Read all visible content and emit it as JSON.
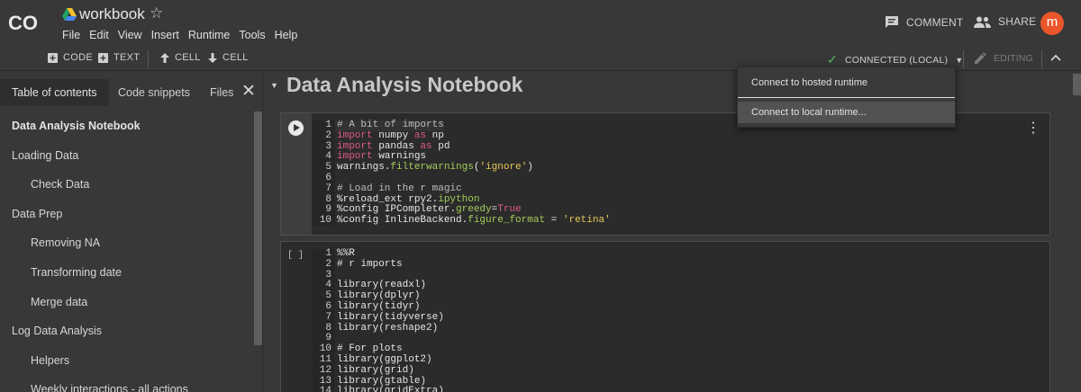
{
  "header": {
    "title": "workbook",
    "menu": [
      "File",
      "Edit",
      "View",
      "Insert",
      "Runtime",
      "Tools",
      "Help"
    ],
    "comment_label": "COMMENT",
    "share_label": "SHARE",
    "avatar_letter": "m",
    "avatar_color": "#e8562a"
  },
  "toolbar": {
    "add_code": "CODE",
    "add_text": "TEXT",
    "cell_up": "CELL",
    "cell_down": "CELL",
    "connection_status": "CONNECTED (LOCAL)",
    "editing_label": "EDITING"
  },
  "dropdown": {
    "items": [
      "Connect to hosted runtime",
      "Connect to local runtime..."
    ]
  },
  "sidebar": {
    "tabs": [
      "Table of contents",
      "Code snippets",
      "Files"
    ],
    "toc": [
      {
        "label": "Data Analysis Notebook",
        "level": 1
      },
      {
        "label": "Loading Data",
        "level": 1
      },
      {
        "label": "Check Data",
        "level": 2
      },
      {
        "label": "Data Prep",
        "level": 1
      },
      {
        "label": "Removing NA",
        "level": 2
      },
      {
        "label": "Transforming date",
        "level": 2
      },
      {
        "label": "Merge data",
        "level": 2
      },
      {
        "label": "Log Data Analysis",
        "level": 1
      },
      {
        "label": "Helpers",
        "level": 2
      },
      {
        "label": "Weekly interactions - all actions",
        "level": 2
      }
    ]
  },
  "main": {
    "section_title": "Data Analysis Notebook",
    "cell2_prompt": "[ ]"
  },
  "colors": {
    "background": "#383838",
    "code_bg": "#2b2b2b",
    "keyword": "#e05a87",
    "function": "#a5cc5a",
    "string": "#e7c95a",
    "connected": "#55b85a"
  }
}
